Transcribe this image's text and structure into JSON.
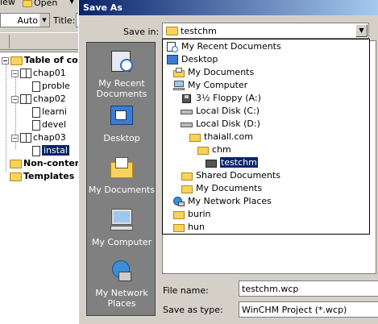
{
  "background_app": {
    "toolbar": {
      "view_label": "iew",
      "open_label": "Open",
      "auto_value": "Auto",
      "title_label": "Title:"
    },
    "tree": [
      {
        "label": "Table of co",
        "bold": true
      },
      {
        "label": "chap01"
      },
      {
        "label": "proble"
      },
      {
        "label": "chap02"
      },
      {
        "label": "learni"
      },
      {
        "label": "devel"
      },
      {
        "label": "chap03"
      },
      {
        "label": "instal",
        "selected": true
      },
      {
        "label": "Non-conter",
        "bold": true
      },
      {
        "label": "Templates",
        "bold": true
      }
    ]
  },
  "dialog": {
    "title": "Save As",
    "save_in_label": "Save in:",
    "save_in_value": "testchm",
    "places": [
      {
        "label": "My Recent Documents",
        "icon": "recent-documents-icon"
      },
      {
        "label": "Desktop",
        "icon": "desktop-icon"
      },
      {
        "label": "My Documents",
        "icon": "my-documents-icon"
      },
      {
        "label": "My Computer",
        "icon": "my-computer-icon"
      },
      {
        "label": "My Network Places",
        "icon": "network-places-icon"
      }
    ],
    "dropdown": [
      {
        "label": "My Recent Documents",
        "icon": "recent-documents-icon",
        "indent": 0
      },
      {
        "label": "Desktop",
        "icon": "desktop-icon",
        "indent": 0
      },
      {
        "label": "My Documents",
        "icon": "my-documents-icon",
        "indent": 1
      },
      {
        "label": "My Computer",
        "icon": "my-computer-icon",
        "indent": 1
      },
      {
        "label": "3½ Floppy (A:)",
        "icon": "floppy-icon",
        "indent": 2
      },
      {
        "label": "Local Disk (C:)",
        "icon": "drive-icon",
        "indent": 2
      },
      {
        "label": "Local Disk (D:)",
        "icon": "drive-icon",
        "indent": 2
      },
      {
        "label": "thaiall.com",
        "icon": "folder-icon",
        "indent": 3
      },
      {
        "label": "chm",
        "icon": "folder-icon",
        "indent": 4
      },
      {
        "label": "testchm",
        "icon": "open-folder-icon",
        "indent": 5,
        "selected": true
      },
      {
        "label": "Shared Documents",
        "icon": "folder-icon",
        "indent": 2
      },
      {
        "label": "My Documents",
        "icon": "folder-icon",
        "indent": 2
      },
      {
        "label": "My Network Places",
        "icon": "network-places-icon",
        "indent": 1
      },
      {
        "label": "burin",
        "icon": "folder-icon",
        "indent": 1
      },
      {
        "label": "hun",
        "icon": "folder-icon",
        "indent": 1
      }
    ],
    "file_name_label": "File name:",
    "file_name_value": "testchm.wcp",
    "save_as_type_label": "Save as type:",
    "save_as_type_value": "WinCHM Project (*.wcp)"
  }
}
